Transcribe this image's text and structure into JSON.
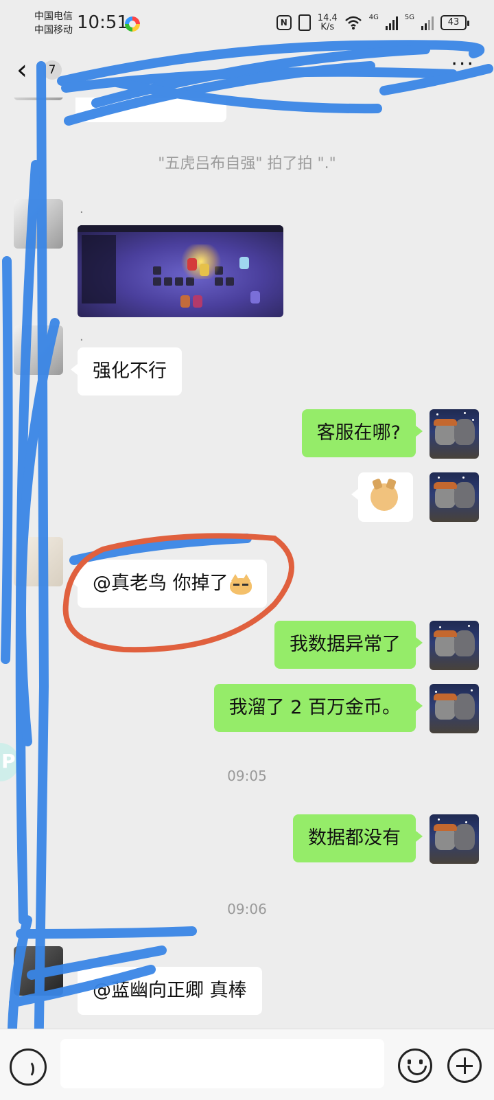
{
  "status_bar": {
    "carrier1": "中国电信",
    "carrier2": "中国移动",
    "time": "10:51",
    "nfc": "N",
    "speed": "14.4",
    "speed_unit": "K/s",
    "net1": "4G",
    "net2": "5G",
    "battery": "43"
  },
  "header": {
    "back_icon": "chevron-left-icon",
    "unread_badge": "7",
    "title": "",
    "more_label": "···"
  },
  "messages": {
    "system_pat": "\"五虎吕布自强\" 拍了拍 \".\"",
    "peer1_name": ".",
    "peer2_name": ".",
    "peer2_text": "强化不行",
    "me1_text": "客服在哪?",
    "me2_sticker": "doge-sticker",
    "peer3_text": "@真老鸟  你掉了",
    "me3_text": "我数据异常了",
    "me4_text": "我溜了 2 百万金币。",
    "time1": "09:05",
    "me5_text": "数据都没有",
    "time2": "09:06",
    "peer4_text": "@蓝幽向正卿  真棒"
  },
  "input_bar": {
    "voice_icon": "voice-icon",
    "placeholder": "",
    "emoji_icon": "smiley-icon",
    "plus_icon": "plus-icon"
  },
  "colors": {
    "bg": "#ededed",
    "bubble_out": "#95ec69",
    "bubble_in": "#ffffff",
    "scribble": "#3a86e6",
    "circle": "#e0603e"
  }
}
